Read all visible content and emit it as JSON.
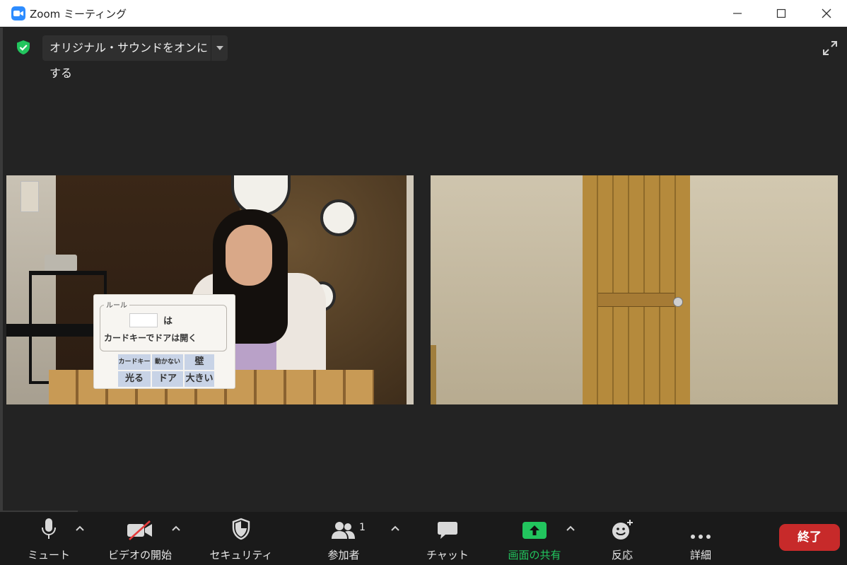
{
  "window": {
    "title": "Zoom ミーティング"
  },
  "meeting_top": {
    "original_sound_button": "オリジナル・サウンドをオンにする"
  },
  "card": {
    "header": "ルール",
    "connector": "は",
    "sentence": "カードキーでドアは開く",
    "chips_row1": [
      "カードキー",
      "動かない",
      "壁"
    ],
    "chips_row2": [
      "光る",
      "ドア",
      "大きい"
    ]
  },
  "toolbar": {
    "mute": "ミュート",
    "start_video": "ビデオの開始",
    "security": "セキュリティ",
    "participants": "参加者",
    "participants_count": "1",
    "chat": "チャット",
    "share_screen": "画面の共有",
    "reactions": "反応",
    "more": "詳細",
    "end": "終了"
  },
  "colors": {
    "zoom_blue": "#2d8cff",
    "share_green": "#22c55e",
    "end_red": "#c72a2a",
    "toolbar_bg": "#1a1a1a",
    "meeting_bg": "#232323"
  }
}
